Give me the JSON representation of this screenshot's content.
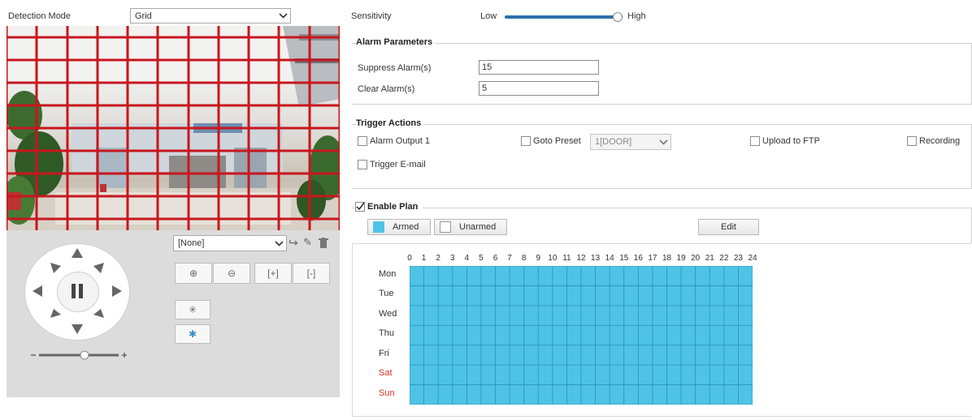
{
  "detection": {
    "label": "Detection Mode",
    "mode": "Grid"
  },
  "ptz": {
    "preset_value": "[None]"
  },
  "sensitivity": {
    "label": "Sensitivity",
    "low": "Low",
    "high": "High",
    "level": 0.95
  },
  "alarm": {
    "title": "Alarm Parameters",
    "suppress_label": "Suppress Alarm(s)",
    "suppress_value": "15",
    "clear_label": "Clear Alarm(s)",
    "clear_value": "5"
  },
  "trigger": {
    "title": "Trigger Actions",
    "alarm_output": "Alarm Output 1",
    "goto_preset": "Goto Preset",
    "preset_option": "1[DOOR]",
    "upload_ftp": "Upload to FTP",
    "recording": "Recording",
    "trigger_email": "Trigger E-mail"
  },
  "plan": {
    "title": "Enable Plan",
    "enabled": true,
    "armed": "Armed",
    "unarmed": "Unarmed",
    "edit": "Edit",
    "hours": [
      "0",
      "1",
      "2",
      "3",
      "4",
      "5",
      "6",
      "7",
      "8",
      "9",
      "10",
      "11",
      "12",
      "13",
      "14",
      "15",
      "16",
      "17",
      "18",
      "19",
      "20",
      "21",
      "22",
      "23",
      "24"
    ],
    "days": [
      "Mon",
      "Tue",
      "Wed",
      "Thu",
      "Fri",
      "Sat",
      "Sun"
    ],
    "weekend_color": "#d9312b",
    "armed_color": "#4fc3e6"
  },
  "colors": {
    "grid_line": "#c8161d"
  }
}
